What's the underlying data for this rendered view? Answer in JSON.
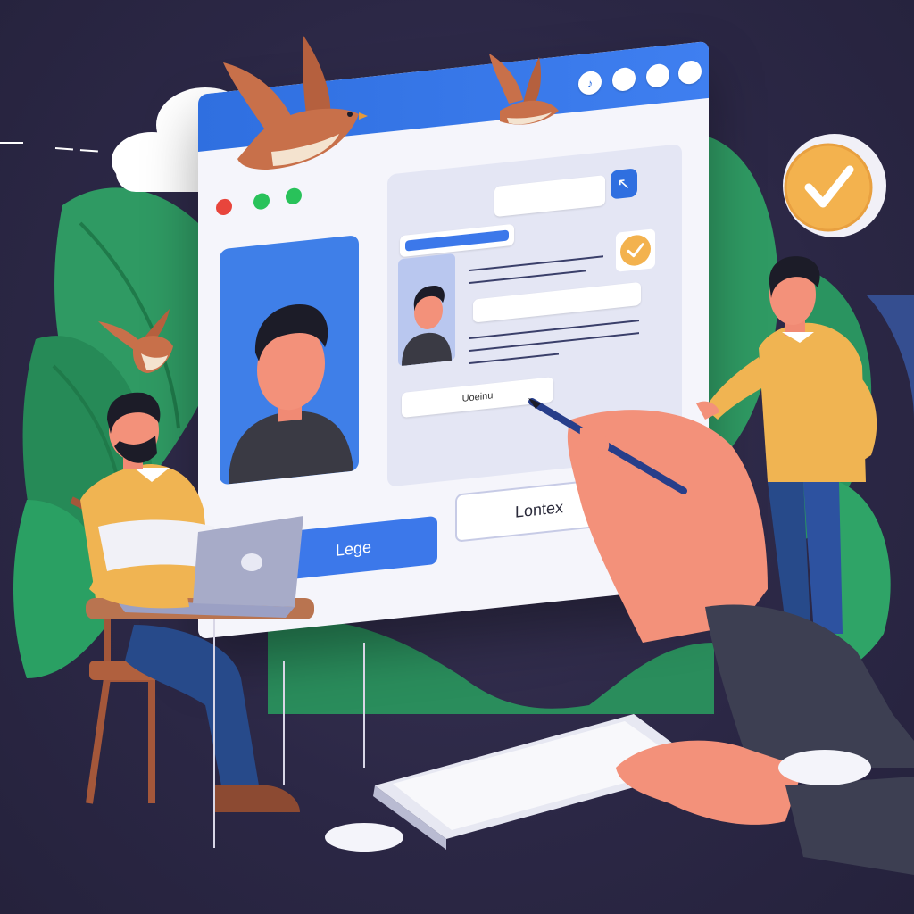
{
  "browser": {
    "input_text": "Uoeinu",
    "primary_button_label": "Lege",
    "secondary_button_label": "Lontex"
  },
  "icons": {
    "title_icon_glyph": "♪",
    "nav_arrow_glyph": "↖"
  },
  "colors": {
    "background": "#2b2745",
    "browser_accent": "#3f7ff0",
    "check_orange": "#f3b24e",
    "leaf_green": "#2f9a63",
    "sweater_yellow": "#f0b452",
    "skin": "#f3917a"
  }
}
